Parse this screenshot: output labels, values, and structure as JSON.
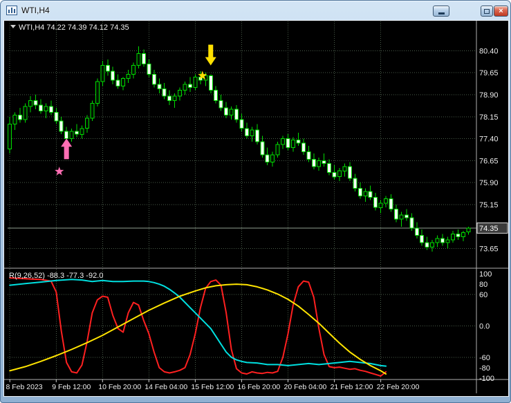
{
  "window": {
    "title": "WTI,H4"
  },
  "chart": {
    "symbol_label": "WTI,H4 74.22 74.39 74.12 74.35",
    "current_price": "74.35",
    "price_axis": [
      "80.40",
      "79.65",
      "78.90",
      "78.15",
      "77.40",
      "76.65",
      "75.90",
      "75.15",
      "73.65"
    ],
    "time_axis": [
      {
        "i": 0,
        "label": "8 Feb 2023"
      },
      {
        "i": 9,
        "label": "9 Feb 12:00"
      },
      {
        "i": 18,
        "label": "10 Feb 20:00"
      },
      {
        "i": 27,
        "label": "14 Feb 04:00"
      },
      {
        "i": 36,
        "label": "15 Feb 12:00"
      },
      {
        "i": 45,
        "label": "16 Feb 20:00"
      },
      {
        "i": 54,
        "label": "20 Feb 04:00"
      },
      {
        "i": 63,
        "label": "21 Feb 12:00"
      },
      {
        "i": 72,
        "label": "22 Feb 20:00"
      }
    ],
    "colors": {
      "background": "#000000",
      "grid": "#4a5d4a",
      "candle_outline": "#00dd00",
      "bull_fill": "#001400",
      "bear_fill": "#f2fff2",
      "axis_text": "#eeeeee",
      "frame": "#b0b0b0",
      "bid_line": "#8fa08f",
      "price_box_bg": "#3a3a3a",
      "price_box_border": "#dddddd",
      "buy_marker": "#ff6eb4",
      "sell_marker": "#ffe000"
    }
  },
  "indicator": {
    "label": "R(9,26,52) -88.3 -77.3 -92.0",
    "levels": [
      "100",
      "80",
      "60",
      "0.0",
      "-60",
      "-80",
      "-100"
    ]
  },
  "chart_data": {
    "type": "candlestick",
    "symbol": "WTI",
    "timeframe": "H4",
    "ohlc_current": {
      "open": 74.22,
      "high": 74.39,
      "low": 74.12,
      "close": 74.35
    },
    "candles": [
      [
        77.05,
        78.15,
        76.9,
        77.9
      ],
      [
        77.9,
        78.3,
        77.7,
        78.2
      ],
      [
        78.2,
        78.45,
        77.95,
        78.05
      ],
      [
        78.05,
        78.6,
        77.95,
        78.5
      ],
      [
        78.5,
        78.85,
        78.3,
        78.7
      ],
      [
        78.7,
        78.9,
        78.4,
        78.55
      ],
      [
        78.55,
        78.75,
        78.25,
        78.35
      ],
      [
        78.35,
        78.6,
        78.1,
        78.5
      ],
      [
        78.5,
        78.7,
        78.2,
        78.3
      ],
      [
        78.3,
        78.45,
        77.9,
        78.0
      ],
      [
        78.0,
        78.15,
        77.55,
        77.65
      ],
      [
        77.65,
        77.8,
        77.25,
        77.4
      ],
      [
        77.4,
        77.75,
        77.3,
        77.65
      ],
      [
        77.65,
        77.9,
        77.45,
        77.55
      ],
      [
        77.55,
        77.85,
        77.4,
        77.75
      ],
      [
        77.75,
        78.2,
        77.6,
        78.1
      ],
      [
        78.1,
        78.7,
        78.0,
        78.6
      ],
      [
        78.6,
        79.45,
        78.5,
        79.35
      ],
      [
        79.35,
        80.05,
        79.2,
        79.9
      ],
      [
        79.9,
        80.1,
        79.55,
        79.7
      ],
      [
        79.7,
        79.85,
        79.25,
        79.4
      ],
      [
        79.4,
        79.6,
        79.1,
        79.2
      ],
      [
        79.2,
        79.5,
        79.05,
        79.45
      ],
      [
        79.45,
        79.75,
        79.3,
        79.6
      ],
      [
        79.6,
        80.0,
        79.45,
        79.9
      ],
      [
        79.9,
        80.55,
        79.8,
        80.3
      ],
      [
        80.3,
        80.45,
        79.85,
        79.95
      ],
      [
        79.95,
        80.1,
        79.5,
        79.6
      ],
      [
        79.6,
        79.75,
        79.15,
        79.25
      ],
      [
        79.25,
        79.45,
        78.95,
        79.1
      ],
      [
        79.1,
        79.3,
        78.75,
        78.85
      ],
      [
        78.85,
        79.05,
        78.55,
        78.7
      ],
      [
        78.7,
        78.95,
        78.45,
        78.85
      ],
      [
        78.85,
        79.15,
        78.7,
        79.05
      ],
      [
        79.05,
        79.35,
        78.9,
        79.25
      ],
      [
        79.25,
        79.5,
        79.0,
        79.15
      ],
      [
        79.15,
        79.6,
        79.05,
        79.5
      ],
      [
        79.5,
        79.7,
        79.25,
        79.4
      ],
      [
        79.4,
        79.65,
        79.2,
        79.55
      ],
      [
        79.55,
        79.6,
        78.95,
        79.05
      ],
      [
        79.05,
        79.2,
        78.6,
        78.7
      ],
      [
        78.7,
        78.9,
        78.35,
        78.45
      ],
      [
        78.45,
        78.65,
        78.1,
        78.2
      ],
      [
        78.2,
        78.5,
        78.05,
        78.4
      ],
      [
        78.4,
        78.55,
        77.95,
        78.05
      ],
      [
        78.05,
        78.25,
        77.65,
        77.75
      ],
      [
        77.75,
        77.95,
        77.4,
        77.5
      ],
      [
        77.5,
        77.8,
        77.3,
        77.7
      ],
      [
        77.7,
        77.9,
        77.2,
        77.3
      ],
      [
        77.3,
        77.5,
        76.75,
        76.85
      ],
      [
        76.85,
        77.1,
        76.5,
        76.6
      ],
      [
        76.6,
        76.95,
        76.45,
        76.85
      ],
      [
        76.85,
        77.3,
        76.75,
        77.2
      ],
      [
        77.2,
        77.5,
        77.05,
        77.4
      ],
      [
        77.4,
        77.55,
        77.0,
        77.1
      ],
      [
        77.1,
        77.45,
        76.95,
        77.35
      ],
      [
        77.35,
        77.6,
        77.15,
        77.25
      ],
      [
        77.25,
        77.4,
        76.85,
        76.95
      ],
      [
        76.95,
        77.15,
        76.6,
        76.7
      ],
      [
        76.7,
        76.9,
        76.35,
        76.45
      ],
      [
        76.45,
        76.75,
        76.3,
        76.65
      ],
      [
        76.65,
        76.9,
        76.45,
        76.55
      ],
      [
        76.55,
        76.7,
        76.15,
        76.25
      ],
      [
        76.25,
        76.5,
        76.0,
        76.1
      ],
      [
        76.1,
        76.4,
        75.95,
        76.3
      ],
      [
        76.3,
        76.55,
        76.1,
        76.45
      ],
      [
        76.45,
        76.6,
        75.95,
        76.05
      ],
      [
        76.05,
        76.2,
        75.6,
        75.7
      ],
      [
        75.7,
        75.9,
        75.35,
        75.45
      ],
      [
        75.45,
        75.7,
        75.25,
        75.6
      ],
      [
        75.6,
        75.8,
        75.3,
        75.4
      ],
      [
        75.4,
        75.55,
        74.95,
        75.05
      ],
      [
        75.05,
        75.3,
        74.85,
        75.2
      ],
      [
        75.2,
        75.45,
        75.05,
        75.35
      ],
      [
        75.35,
        75.5,
        74.9,
        75.0
      ],
      [
        75.0,
        75.15,
        74.55,
        74.65
      ],
      [
        74.65,
        74.9,
        74.4,
        74.8
      ],
      [
        74.8,
        75.0,
        74.6,
        74.7
      ],
      [
        74.7,
        74.85,
        74.25,
        74.35
      ],
      [
        74.35,
        74.55,
        74.0,
        74.1
      ],
      [
        74.1,
        74.3,
        73.75,
        73.85
      ],
      [
        73.85,
        74.05,
        73.6,
        73.7
      ],
      [
        73.7,
        73.95,
        73.55,
        73.85
      ],
      [
        73.85,
        74.1,
        73.7,
        74.0
      ],
      [
        74.0,
        74.15,
        73.75,
        73.85
      ],
      [
        73.85,
        74.05,
        73.65,
        73.95
      ],
      [
        73.95,
        74.25,
        73.85,
        74.15
      ],
      [
        74.15,
        74.3,
        73.95,
        74.05
      ],
      [
        74.05,
        74.25,
        73.9,
        74.2
      ],
      [
        74.22,
        74.39,
        74.12,
        74.35
      ]
    ],
    "oscillator": {
      "name": "R(9,26,52)",
      "current_values": [
        -88.3,
        -77.3,
        -92.0
      ],
      "range": [
        -100,
        100
      ],
      "series": [
        {
          "name": "r9",
          "color": "#ff2020",
          "points": [
            [
              0,
              92
            ],
            [
              2,
              91
            ],
            [
              4,
              90
            ],
            [
              6,
              89
            ],
            [
              8,
              86
            ],
            [
              9,
              65
            ],
            [
              10,
              -10
            ],
            [
              11,
              -70
            ],
            [
              12,
              -88
            ],
            [
              13,
              -90
            ],
            [
              14,
              -75
            ],
            [
              15,
              -30
            ],
            [
              16,
              25
            ],
            [
              17,
              50
            ],
            [
              18,
              57
            ],
            [
              19,
              55
            ],
            [
              20,
              20
            ],
            [
              21,
              -5
            ],
            [
              22,
              -12
            ],
            [
              23,
              25
            ],
            [
              24,
              45
            ],
            [
              25,
              40
            ],
            [
              26,
              10
            ],
            [
              27,
              -15
            ],
            [
              28,
              -50
            ],
            [
              29,
              -80
            ],
            [
              30,
              -88
            ],
            [
              31,
              -90
            ],
            [
              32,
              -88
            ],
            [
              33,
              -85
            ],
            [
              34,
              -80
            ],
            [
              35,
              -55
            ],
            [
              36,
              -15
            ],
            [
              37,
              35
            ],
            [
              38,
              72
            ],
            [
              39,
              85
            ],
            [
              40,
              88
            ],
            [
              41,
              78
            ],
            [
              42,
              25
            ],
            [
              43,
              -45
            ],
            [
              44,
              -82
            ],
            [
              45,
              -90
            ],
            [
              46,
              -92
            ],
            [
              47,
              -88
            ],
            [
              48,
              -90
            ],
            [
              49,
              -91
            ],
            [
              50,
              -89
            ],
            [
              51,
              -90
            ],
            [
              52,
              -87
            ],
            [
              53,
              -60
            ],
            [
              54,
              -15
            ],
            [
              55,
              40
            ],
            [
              56,
              75
            ],
            [
              57,
              86
            ],
            [
              58,
              84
            ],
            [
              59,
              55
            ],
            [
              60,
              -5
            ],
            [
              61,
              -55
            ],
            [
              62,
              -78
            ],
            [
              63,
              -80
            ],
            [
              64,
              -79
            ],
            [
              65,
              -81
            ],
            [
              66,
              -83
            ],
            [
              67,
              -82
            ],
            [
              68,
              -85
            ],
            [
              69,
              -87
            ],
            [
              70,
              -90
            ],
            [
              71,
              -93
            ],
            [
              72,
              -96
            ],
            [
              73,
              -88
            ]
          ]
        },
        {
          "name": "r26",
          "color": "#00e0e0",
          "points": [
            [
              0,
              78
            ],
            [
              3,
              81
            ],
            [
              6,
              84
            ],
            [
              9,
              87
            ],
            [
              12,
              89
            ],
            [
              14,
              88
            ],
            [
              16,
              85
            ],
            [
              18,
              87
            ],
            [
              20,
              85
            ],
            [
              22,
              85
            ],
            [
              24,
              86
            ],
            [
              26,
              86
            ],
            [
              27,
              85
            ],
            [
              28,
              83
            ],
            [
              29,
              80
            ],
            [
              30,
              76
            ],
            [
              31,
              70
            ],
            [
              32,
              63
            ],
            [
              33,
              55
            ],
            [
              34,
              45
            ],
            [
              35,
              35
            ],
            [
              36,
              25
            ],
            [
              37,
              15
            ],
            [
              38,
              5
            ],
            [
              39,
              -5
            ],
            [
              40,
              -20
            ],
            [
              41,
              -35
            ],
            [
              42,
              -50
            ],
            [
              43,
              -60
            ],
            [
              44,
              -65
            ],
            [
              45,
              -68
            ],
            [
              46,
              -70
            ],
            [
              48,
              -71
            ],
            [
              50,
              -74
            ],
            [
              52,
              -74
            ],
            [
              54,
              -76
            ],
            [
              56,
              -74
            ],
            [
              58,
              -72
            ],
            [
              60,
              -74
            ],
            [
              62,
              -72
            ],
            [
              64,
              -70
            ],
            [
              66,
              -68
            ],
            [
              68,
              -70
            ],
            [
              70,
              -72
            ],
            [
              72,
              -76
            ],
            [
              73,
              -77
            ]
          ]
        },
        {
          "name": "r52",
          "color": "#ffe400",
          "points": [
            [
              0,
              -86
            ],
            [
              3,
              -78
            ],
            [
              6,
              -68
            ],
            [
              9,
              -57
            ],
            [
              12,
              -45
            ],
            [
              15,
              -32
            ],
            [
              18,
              -18
            ],
            [
              21,
              -2
            ],
            [
              24,
              14
            ],
            [
              27,
              30
            ],
            [
              30,
              44
            ],
            [
              33,
              57
            ],
            [
              36,
              67
            ],
            [
              38,
              73
            ],
            [
              40,
              77
            ],
            [
              42,
              79
            ],
            [
              44,
              80
            ],
            [
              46,
              79
            ],
            [
              48,
              75
            ],
            [
              50,
              69
            ],
            [
              52,
              61
            ],
            [
              54,
              51
            ],
            [
              56,
              38
            ],
            [
              58,
              22
            ],
            [
              60,
              5
            ],
            [
              62,
              -14
            ],
            [
              64,
              -33
            ],
            [
              66,
              -50
            ],
            [
              68,
              -64
            ],
            [
              70,
              -76
            ],
            [
              72,
              -86
            ],
            [
              73,
              -92
            ]
          ]
        }
      ]
    },
    "markers": [
      {
        "shape": "arrow-up",
        "name": "buy-arrow",
        "color": "#ff6eb4",
        "i": 11,
        "price": 76.7
      },
      {
        "shape": "star",
        "name": "buy-star",
        "color": "#ff6eb4",
        "i": 9.6,
        "price": 76.28
      },
      {
        "shape": "arrow-down",
        "name": "sell-arrow",
        "color": "#ffe000",
        "i": 39,
        "price": 79.9
      },
      {
        "shape": "star",
        "name": "sell-star",
        "color": "#ffe000",
        "i": 37.4,
        "price": 79.55
      }
    ]
  }
}
